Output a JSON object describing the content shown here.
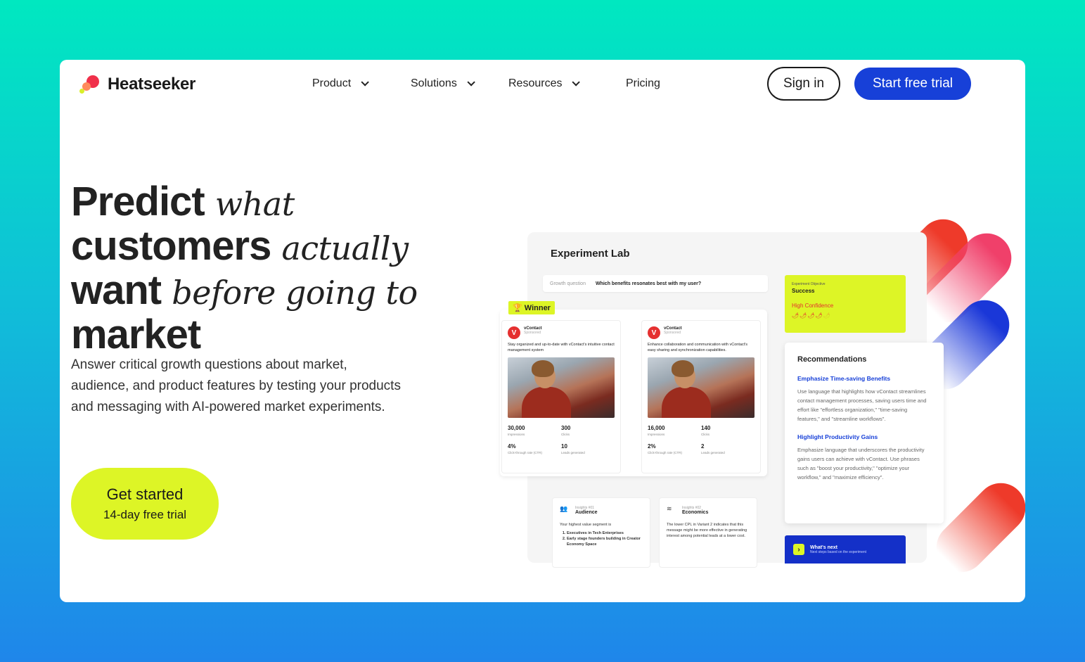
{
  "brand": {
    "name": "Heatseeker"
  },
  "nav": {
    "items": [
      {
        "label": "Product",
        "dropdown": true
      },
      {
        "label": "Solutions",
        "dropdown": true
      },
      {
        "label": "Resources",
        "dropdown": true
      },
      {
        "label": "Pricing",
        "dropdown": false
      }
    ],
    "sign_in": "Sign in",
    "start_trial": "Start free trial"
  },
  "hero": {
    "title_parts": [
      {
        "text": "Predict",
        "style": "strong"
      },
      {
        "text": "what",
        "style": "italic"
      },
      {
        "text": "customers",
        "style": "strong"
      },
      {
        "text": "actually",
        "style": "italic"
      },
      {
        "text": "want",
        "style": "strong"
      },
      {
        "text": "before going to",
        "style": "italic"
      },
      {
        "text": "market",
        "style": "strong"
      }
    ],
    "subtitle": "Answer critical growth questions about market, audience, and product features by testing your products and messaging with AI-powered market experiments.",
    "cta_main": "Get started",
    "cta_sub": "14-day free trial"
  },
  "lab": {
    "title": "Experiment Lab",
    "growth_question_label": "Growth question",
    "growth_question": "Which benefits resonates best with my user?",
    "winner": "🏆 Winner",
    "ads": [
      {
        "brand": "vContact",
        "sponsored": "Sponsored",
        "text": "Stay organized and up-to-date with vContact's intuitive contact management system",
        "stats": [
          {
            "value": "30,000",
            "label": "Impressions"
          },
          {
            "value": "300",
            "label": "Clicks"
          },
          {
            "value": "4%",
            "label": "Click-through rate (CTR)"
          },
          {
            "value": "10",
            "label": "Leads generated"
          }
        ]
      },
      {
        "brand": "vContact",
        "sponsored": "Sponsored",
        "text": "Enhance collaboration and communication with vContact's easy sharing and synchronization capabilities.",
        "stats": [
          {
            "value": "16,000",
            "label": "Impressions"
          },
          {
            "value": "140",
            "label": "Clicks"
          },
          {
            "value": "2%",
            "label": "Click-through rate (CTR)"
          },
          {
            "value": "2",
            "label": "Leads generated"
          }
        ]
      }
    ],
    "objective": {
      "label": "Experiment Objective",
      "status": "Success",
      "confidence": "High Confidence"
    },
    "recommendations": {
      "title": "Recommendations",
      "items": [
        {
          "title": "Emphasize Time-saving Benefits",
          "body": "Use language that highlights how vContact streamlines contact management processes, saving users time and effort like \"effortless organization,\" \"time-saving features,\" and \"streamline workflows\"."
        },
        {
          "title": "Highlight Productivity Gains",
          "body": "Emphasize language that underscores the productivity gains users can achieve with vContact. Use phrases such as \"boost your productivity,\" \"optimize your workflow,\" and \"maximize efficiency\"."
        }
      ]
    },
    "insights": [
      {
        "key": "Insights #01",
        "title": "Audience",
        "body": "Your highest value segment is",
        "list": [
          "Executives in Tech Enterprises",
          "Early stage founders building in Creator Economy Space"
        ]
      },
      {
        "key": "Insights #02",
        "title": "Economics",
        "body": "The lower CPL in Variant 2 indicates that this message might be more effective in generating interest among potential leads at a lower cost.",
        "list": []
      }
    ],
    "next": {
      "title": "What's next",
      "sub": "Next steps based on the experiment"
    }
  },
  "colors": {
    "accent_blue": "#1740d8",
    "lime": "#ddf526",
    "red": "#e53030"
  }
}
